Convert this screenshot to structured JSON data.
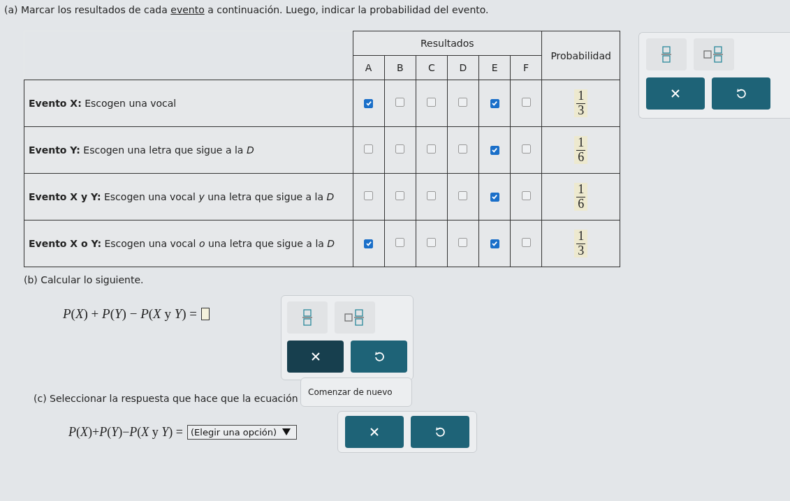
{
  "part_a": {
    "before": "(a) Marcar los resultados de cada ",
    "link": "evento",
    "after": " a continuación. Luego, indicar la probabilidad del evento."
  },
  "table": {
    "group_header": "Resultados",
    "columns": [
      "A",
      "B",
      "C",
      "D",
      "E",
      "F"
    ],
    "probability_header": "Probabilidad",
    "rows": [
      {
        "event": "**Evento X:** Escogen una vocal",
        "results": [
          {
            "checked": true
          },
          {
            "checked": false
          },
          {
            "checked": false
          },
          {
            "checked": false
          },
          {
            "checked": true
          },
          {
            "checked": false
          }
        ],
        "probability": {
          "numerator": "1",
          "denominator": "3"
        }
      },
      {
        "event": "**Evento Y:** Escogen una letra que sigue a la *D*",
        "results": [
          {
            "checked": false
          },
          {
            "checked": false
          },
          {
            "checked": false
          },
          {
            "checked": false
          },
          {
            "checked": true
          },
          {
            "checked": false
          }
        ],
        "probability": {
          "numerator": "1",
          "denominator": "6"
        }
      },
      {
        "event": "**Evento X y Y:** Escogen una vocal *y* una letra que sigue a la *D*",
        "results": [
          {
            "checked": false
          },
          {
            "checked": false
          },
          {
            "checked": false
          },
          {
            "checked": false
          },
          {
            "checked": true
          },
          {
            "checked": false
          }
        ],
        "probability": {
          "numerator": "1",
          "denominator": "6"
        }
      },
      {
        "event": "**Evento X o Y:** Escogen una vocal *o* una letra que sigue a la *D*",
        "results": [
          {
            "checked": true
          },
          {
            "checked": false
          },
          {
            "checked": false
          },
          {
            "checked": false
          },
          {
            "checked": true
          },
          {
            "checked": false
          }
        ],
        "probability": {
          "numerator": "1",
          "denominator": "3"
        }
      }
    ]
  },
  "part_b": {
    "heading": "(b) Calcular lo siguiente.",
    "equation": "*P*(*X*) + *P*(*Y*) − *P*(*X* y *Y*) ="
  },
  "tooltip": "Comenzar de nuevo",
  "part_c": {
    "heading": "(c) Seleccionar la respuesta que hace que la ecuación",
    "equation": "*P*(*X*)+*P*(*Y*)−*P*(*X* y *Y*) =",
    "dropdown": "(Elegir una opción)"
  }
}
